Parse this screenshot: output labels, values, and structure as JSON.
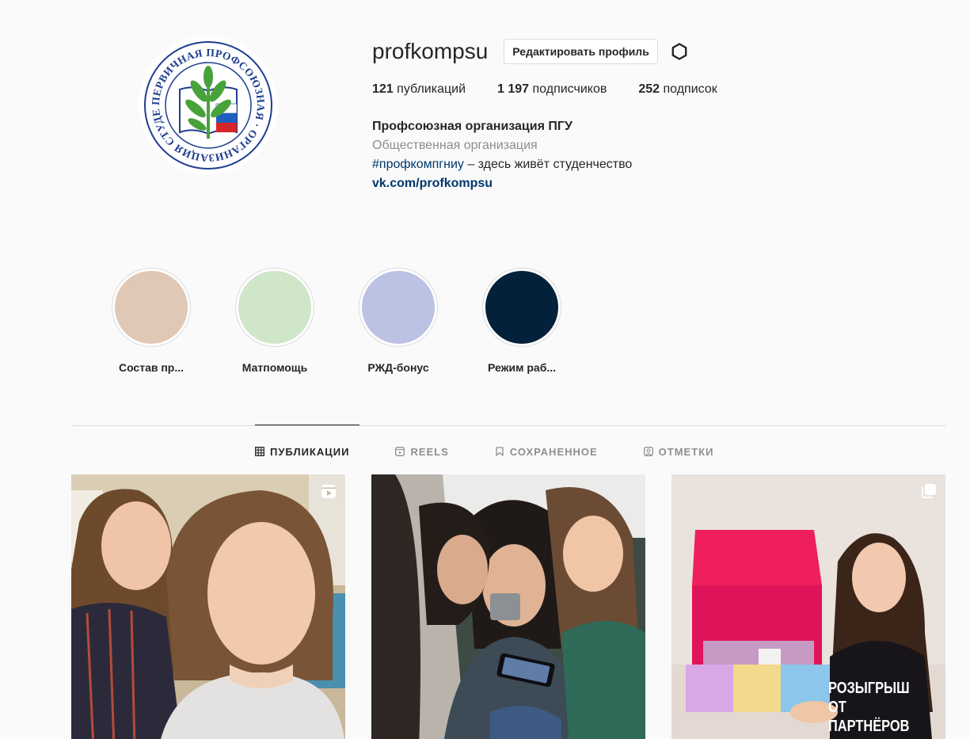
{
  "profile": {
    "username": "profkompsu",
    "edit_button": "Редактировать профиль",
    "stats": [
      {
        "count": "121",
        "label": "публикаций"
      },
      {
        "count": "1 197",
        "label": "подписчиков"
      },
      {
        "count": "252",
        "label": "подписок"
      }
    ],
    "bio": {
      "name": "Профсоюзная организация ПГУ",
      "category": "Общественная организация",
      "hashtag": "#профкомпгниу",
      "text": " – здесь живёт студенчество",
      "link": "vk.com/profkompsu"
    },
    "avatar_text": "ПЕРВИЧНАЯ ПРОФСОЮЗНАЯ · ОРГАНИЗАЦИЯ СТУДЕНТОВ ПГУ ·"
  },
  "highlights": [
    {
      "label": "Состав пр...",
      "color": "#e0c8b6"
    },
    {
      "label": "Матпомощь",
      "color": "#cfe6c8"
    },
    {
      "label": "РЖД-бонус",
      "color": "#bcc2e4"
    },
    {
      "label": "Режим раб...",
      "color": "#03213a"
    }
  ],
  "tabs": [
    {
      "label": "ПУБЛИКАЦИИ",
      "icon": "grid-icon",
      "active": true
    },
    {
      "label": "REELS",
      "icon": "reels-icon",
      "active": false
    },
    {
      "label": "СОХРАНЕННОЕ",
      "icon": "bookmark-icon",
      "active": false
    },
    {
      "label": "ОТМЕТКИ",
      "icon": "tagged-icon",
      "active": false
    }
  ],
  "posts": [
    {
      "type": "reel",
      "badge_icon": "reel-icon"
    },
    {
      "type": "photo"
    },
    {
      "type": "carousel",
      "badge_icon": "carousel-icon",
      "overlay_line1": "РОЗЫГРЫШ",
      "overlay_line2": "ОТ ПАРТНЁРОВ"
    }
  ],
  "colors": {
    "link": "#00376b",
    "muted": "#8e8e8e",
    "text": "#262626",
    "border": "#dbdbdb",
    "avatar_navy": "#1d3d8f",
    "avatar_green": "#47a23a"
  }
}
